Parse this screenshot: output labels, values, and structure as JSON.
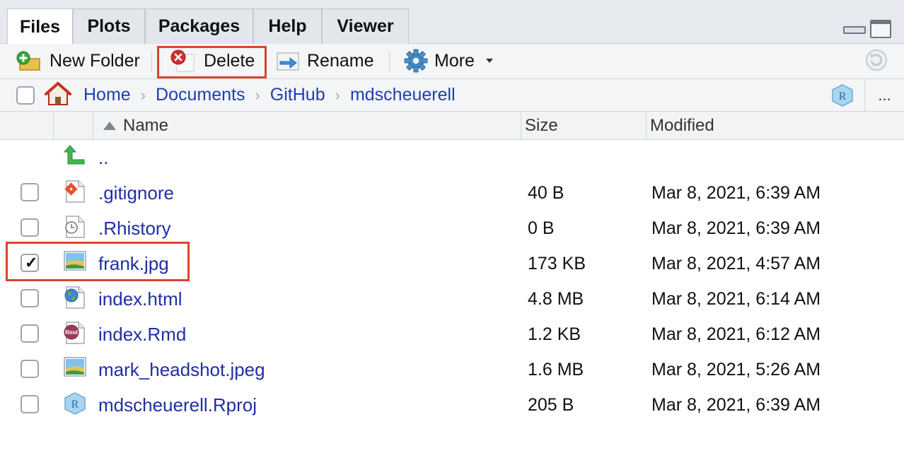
{
  "tabs": [
    {
      "label": "Files",
      "active": true
    },
    {
      "label": "Plots",
      "active": false
    },
    {
      "label": "Packages",
      "active": false
    },
    {
      "label": "Help",
      "active": false
    },
    {
      "label": "Viewer",
      "active": false
    }
  ],
  "toolbar": {
    "new_folder": "New Folder",
    "delete": "Delete",
    "rename": "Rename",
    "more": "More"
  },
  "breadcrumb": [
    "Home",
    "Documents",
    "GitHub",
    "mdscheuerell"
  ],
  "more_menu_label": "...",
  "columns": {
    "name": "Name",
    "size": "Size",
    "modified": "Modified"
  },
  "parent_link": "..",
  "files": [
    {
      "name": ".gitignore",
      "size": "40 B",
      "modified": "Mar 8, 2021, 6:39 AM",
      "icon": "git-file-icon",
      "checked": false
    },
    {
      "name": ".Rhistory",
      "size": "0 B",
      "modified": "Mar 8, 2021, 6:39 AM",
      "icon": "history-file-icon",
      "checked": false
    },
    {
      "name": "frank.jpg",
      "size": "173 KB",
      "modified": "Mar 8, 2021, 4:57 AM",
      "icon": "image-file-icon",
      "checked": true
    },
    {
      "name": "index.html",
      "size": "4.8 MB",
      "modified": "Mar 8, 2021, 6:14 AM",
      "icon": "html-file-icon",
      "checked": false
    },
    {
      "name": "index.Rmd",
      "size": "1.2 KB",
      "modified": "Mar 8, 2021, 6:12 AM",
      "icon": "rmd-file-icon",
      "checked": false
    },
    {
      "name": "mark_headshot.jpeg",
      "size": "1.6 MB",
      "modified": "Mar 8, 2021, 5:26 AM",
      "icon": "image-file-icon",
      "checked": false
    },
    {
      "name": "mdscheuerell.Rproj",
      "size": "205 B",
      "modified": "Mar 8, 2021, 6:39 AM",
      "icon": "rproj-file-icon",
      "checked": false
    }
  ],
  "colors": {
    "link": "#1f2fa6",
    "highlight": "#e0422b",
    "tab_bg": "#e6e9ee"
  }
}
